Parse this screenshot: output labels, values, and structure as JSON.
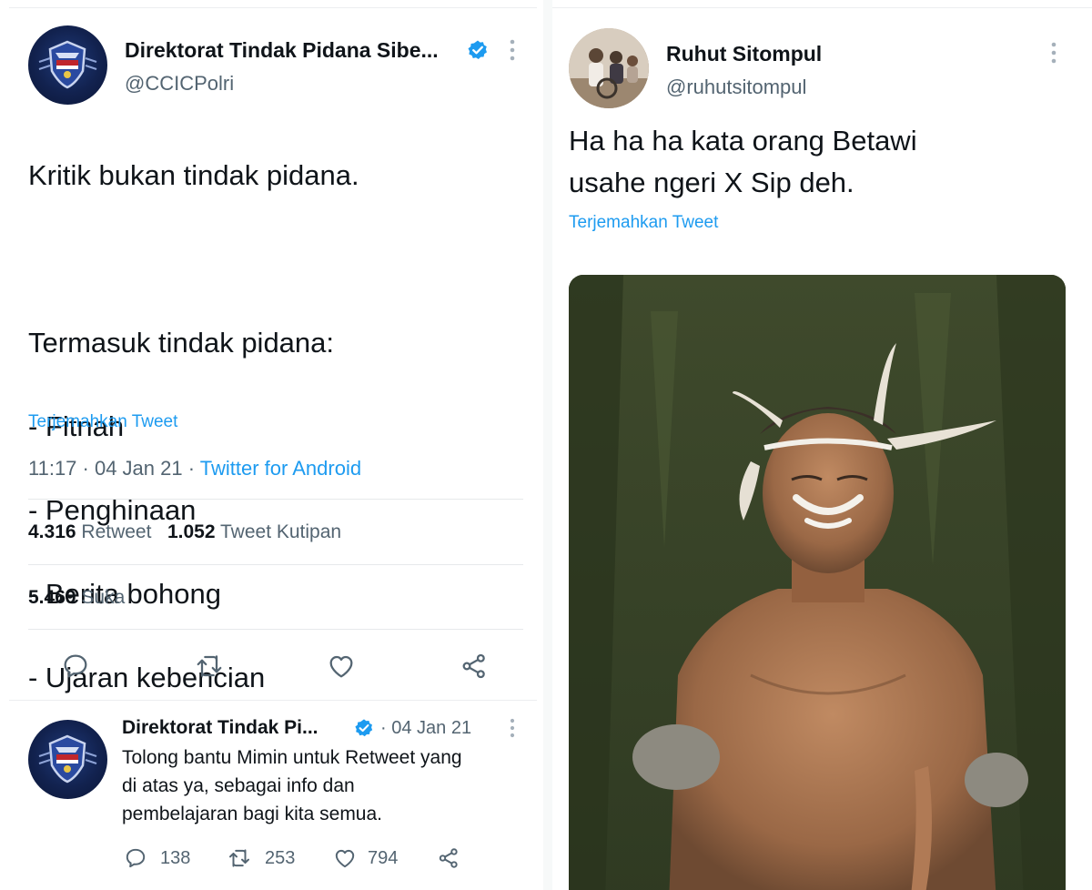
{
  "left_tweet": {
    "author_name": "Direktorat Tindak Pidana Sibe...",
    "handle": "@CCICPolri",
    "text_lines": [
      "Kritik bukan tindak pidana.",
      "",
      "Termasuk tindak pidana:",
      "- Fitnah",
      "- Penghinaan",
      "- Berita bohong",
      "- Ujaran kebencian"
    ],
    "translate_label": "Terjemahkan Tweet",
    "time": "11:17 · 04 Jan 21 · ",
    "source": "Twitter for Android",
    "retweet_count": "4.316",
    "retweet_label": "Retweet",
    "quote_count": "1.052",
    "quote_label": "Tweet Kutipan",
    "like_count": "5.469",
    "like_label": "Suka"
  },
  "reply_tweet": {
    "author_name": "Direktorat Tindak Pi...",
    "date": "· 04 Jan 21",
    "text": "Tolong bantu Mimin untuk Retweet yang\ndi atas ya, sebagai info dan\npembelajaran bagi kita semua.",
    "reply_count": "138",
    "retweet_count": "253",
    "like_count": "794"
  },
  "right_tweet": {
    "author_name": "Ruhut Sitompul",
    "handle": "@ruhutsitompul",
    "text": "Ha ha ha kata orang Betawi\nusahe ngeri X Sip deh.",
    "translate_label": "Terjemahkan Tweet"
  },
  "colors": {
    "link": "#1d9bf0",
    "verified": "#1d9bf0",
    "secondary_text": "#536471"
  }
}
